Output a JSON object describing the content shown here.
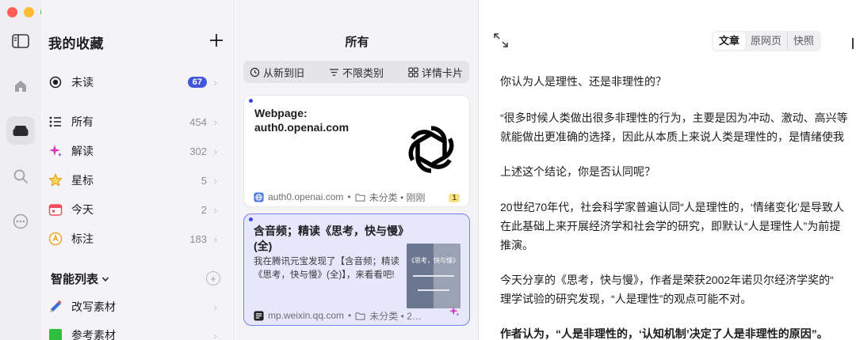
{
  "window": {
    "traffic_colors": [
      "#ff5f57",
      "#febc2e",
      "#28c840"
    ]
  },
  "rail": {
    "icons": [
      "sidebar-toggle-icon",
      "home-icon",
      "tray-icon",
      "search-icon",
      "more-icon"
    ]
  },
  "sidebar": {
    "title": "我的收藏",
    "add_label": "+",
    "items": [
      {
        "label": "未读",
        "count": "67",
        "icon": "radio-icon"
      },
      {
        "label": "所有",
        "count": "454",
        "icon": "list-icon"
      },
      {
        "label": "解读",
        "count": "302",
        "icon": "sparkle-icon"
      },
      {
        "label": "星标",
        "count": "5",
        "icon": "star-icon"
      },
      {
        "label": "今天",
        "count": "2",
        "icon": "calendar-icon"
      },
      {
        "label": "标注",
        "count": "183",
        "icon": "highlight-icon"
      }
    ],
    "smart_section": "智能列表",
    "smart_items": [
      {
        "label": "改写素材",
        "icon": "pen-icon"
      },
      {
        "label": "参考素材",
        "icon": "green-square-icon"
      }
    ],
    "chevron": "›"
  },
  "list": {
    "title": "所有",
    "filters": {
      "sort": "从新到旧",
      "category": "不限类别",
      "view": "详情卡片"
    },
    "cards": [
      {
        "title": "Webpage: auth0.openai.com",
        "domain": "auth0.openai.com",
        "meta": "未分类 • 刚刚",
        "pin": "1"
      },
      {
        "title": "含音频；精读《思考，快与慢》(全)",
        "summary": "我在腾讯元宝发现了【含音频；精读《思考，快与慢》(全)】，来看看吧!",
        "domain": "mp.weixin.qq.com",
        "meta": "未分类 • 2…",
        "thumb_text": "《思考，快与慢》"
      }
    ]
  },
  "reader": {
    "tabs": [
      "文章",
      "原网页",
      "快照"
    ],
    "active_tab": "文章",
    "paragraphs": [
      "你认为人是理性、还是非理性的？",
      "“很多时候人类做出很多非理性的行为，主要是因为冲动、激动、高兴等",
      "就能做出更准确的选择，因此从本质上来说人类是理性的，是情绪使我",
      "上述这个结论，你是否认同呢？",
      "20世纪70年代，社会科学家普遍认同“人是理性的，‘情绪变化’是导致人",
      "在此基础上来开展经济学和社会学的研究，即默认“人是理性人”为前提",
      "推演。",
      "今天分享的《思考，快与慢》，作者是荣获2002年诺贝尔经济学奖的“",
      "理学试验的研究发现，“人是理性”的观点可能不对。",
      "作者认为，“人是非理性的，‘认知机制’决定了人是非理性的原因”。"
    ]
  }
}
